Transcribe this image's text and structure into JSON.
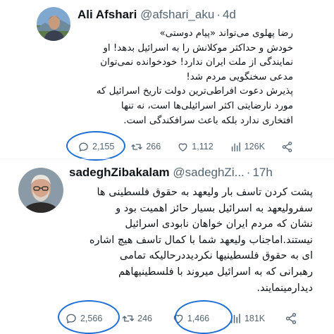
{
  "tweets": [
    {
      "author_name": "Ali Afshari",
      "handle": "@afshari_aku",
      "separator": "·",
      "time": "4d",
      "body_lines": [
        "رضا پهلوی می‌تواند «پیام دوستی»",
        "خودش و حداکثر موکلانش را به اسرائیل بدهد! او",
        "نمایندگی از ملت ایران ندارد! خودخوانده نمی‌توان",
        "مدعی سخنگویی مردم شد!",
        "پذیرش دعوت افراطی‌ترین دولت تاریخ اسرائیل که",
        "مورد نارضایتی اکثر اسرائیلی‌ها است، نه تنها",
        "افتخاری ندارد بلکه باعث سرافکندگی است."
      ],
      "replies": "2,155",
      "retweets": "266",
      "likes": "1,112",
      "views": "126K"
    },
    {
      "author_name": "sadeghZibakalam",
      "handle": "@sadeghZi...",
      "separator": "·",
      "time": "17h",
      "body_lines": [
        "پشت کردن تاسف بار ولیعهد به حقوق فلسطینی ها",
        "سفرولیعهد به اسرائیل بسیار حائز اهمیت بود و",
        "نشان که مردم ایران خواهان نابودی اسرائیل",
        "نیستند.اماجناب ولیعهد شما با کمال تاسف هیچ اشاره",
        "ای به حقوق فلسطینیها نکردیددرحالیکه تمامی",
        "رهبرانی که به اسرائیل میروند با فلسطینیهاهم",
        "دیدارمینمایند."
      ],
      "replies": "2,566",
      "retweets": "246",
      "likes": "1,466",
      "views": "181K"
    }
  ],
  "icons": {
    "reply": "reply-icon",
    "retweet": "retweet-icon",
    "like": "heart-icon",
    "views": "views-icon",
    "share": "share-icon"
  },
  "colors": {
    "text": "#0f1419",
    "secondary": "#536471",
    "annotation_circle": "#1d6fd6",
    "divider": "#eff3f4"
  }
}
